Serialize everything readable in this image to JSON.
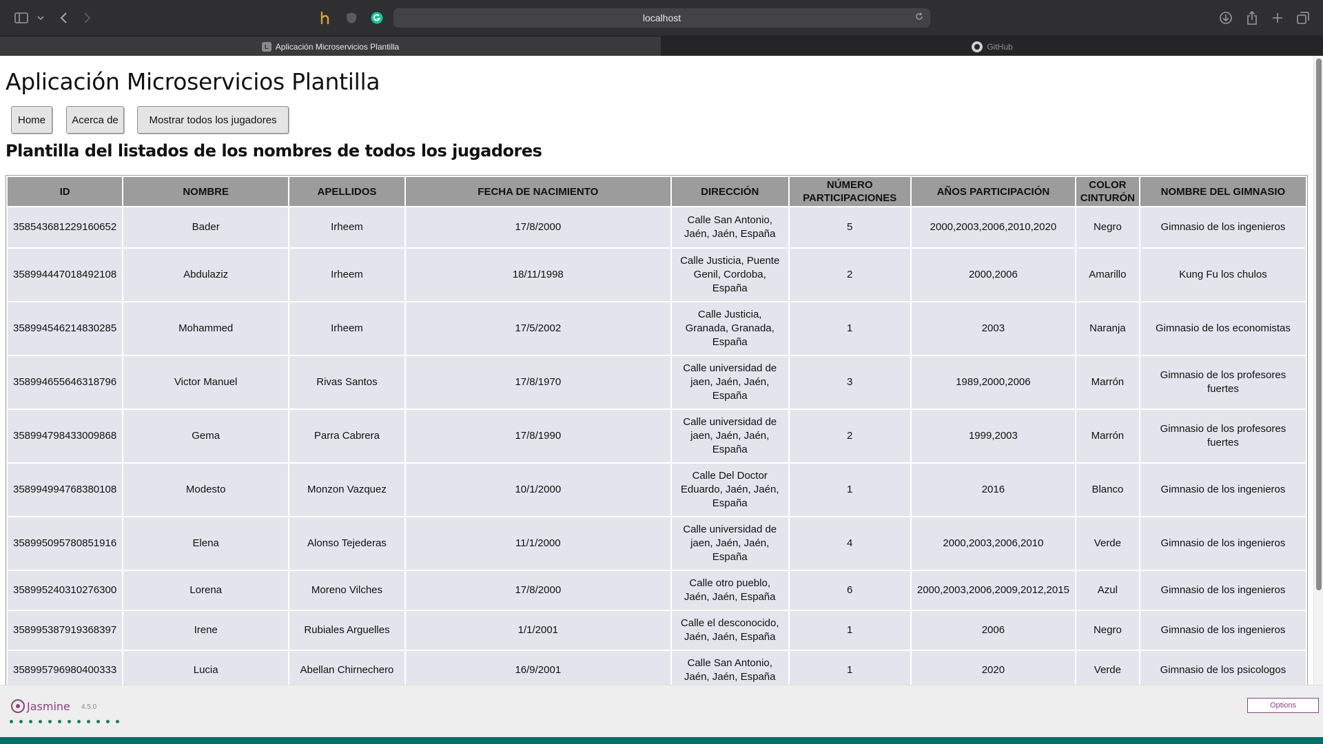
{
  "browser": {
    "url": "localhost",
    "tabs": [
      {
        "label": "Aplicación Microservicios Plantilla",
        "favicon": "L"
      },
      {
        "label": "GitHub"
      }
    ]
  },
  "page": {
    "title": "Aplicación Microservicios Plantilla",
    "nav": [
      "Home",
      "Acerca de",
      "Mostrar todos los jugadores"
    ],
    "subtitle": "Plantilla del listados de los nombres de todos los jugadores"
  },
  "table": {
    "headers": [
      "ID",
      "Nombre",
      "Apellidos",
      "Fecha de nacimiento",
      "Dirección",
      "Número participaciones",
      "Años participación",
      "Color cinturón",
      "Nombre del gimnasio"
    ],
    "rows": [
      [
        "358543681229160652",
        "Bader",
        "Irheem",
        "17/8/2000",
        "Calle San Antonio, Jaén, Jaén, España",
        "5",
        "2000,2003,2006,2010,2020",
        "Negro",
        "Gimnasio de los ingenieros"
      ],
      [
        "358994447018492108",
        "Abdulaziz",
        "Irheem",
        "18/11/1998",
        "Calle Justicia, Puente Genil, Cordoba, España",
        "2",
        "2000,2006",
        "Amarillo",
        "Kung Fu los chulos"
      ],
      [
        "358994546214830285",
        "Mohammed",
        "Irheem",
        "17/5/2002",
        "Calle Justicia, Granada, Granada, España",
        "1",
        "2003",
        "Naranja",
        "Gimnasio de los economistas"
      ],
      [
        "358994655646318796",
        "Victor Manuel",
        "Rivas Santos",
        "17/8/1970",
        "Calle universidad de jaen, Jaén, Jaén, España",
        "3",
        "1989,2000,2006",
        "Marrón",
        "Gimnasio de los profesores fuertes"
      ],
      [
        "358994798433009868",
        "Gema",
        "Parra Cabrera",
        "17/8/1990",
        "Calle universidad de jaen, Jaén, Jaén, España",
        "2",
        "1999,2003",
        "Marrón",
        "Gimnasio de los profesores fuertes"
      ],
      [
        "358994994768380108",
        "Modesto",
        "Monzon Vazquez",
        "10/1/2000",
        "Calle Del Doctor Eduardo, Jaén, Jaén, España",
        "1",
        "2016",
        "Blanco",
        "Gimnasio de los ingenieros"
      ],
      [
        "358995095780851916",
        "Elena",
        "Alonso Tejederas",
        "11/1/2000",
        "Calle universidad de jaen, Jaén, Jaén, España",
        "4",
        "2000,2003,2006,2010",
        "Verde",
        "Gimnasio de los ingenieros"
      ],
      [
        "358995240310276300",
        "Lorena",
        "Moreno Vilches",
        "17/8/2000",
        "Calle otro pueblo, Jaén, Jaén, España",
        "6",
        "2000,2003,2006,2009,2012,2015",
        "Azul",
        "Gimnasio de los ingenieros"
      ],
      [
        "358995387919368397",
        "Irene",
        "Rubiales Arguelles",
        "1/1/2001",
        "Calle el desconocido, Jaén, Jaén, España",
        "1",
        "2006",
        "Negro",
        "Gimnasio de los ingenieros"
      ],
      [
        "358995796980400333",
        "Lucia",
        "Abellan Chirnechero",
        "16/9/2001",
        "Calle San Antonio, Jaén, Jaén, España",
        "1",
        "2020",
        "Verde",
        "Gimnasio de los psicologos"
      ]
    ]
  },
  "jasmine": {
    "name": "Jasmine",
    "version": "4.5.0",
    "options_label": "Options",
    "brand_color": "#8a4182",
    "bar_color": "#007069"
  },
  "icons": [
    "sidebar-icon",
    "chevron-down-icon",
    "back-icon",
    "forward-icon",
    "extension-icon",
    "shield-icon",
    "grammarly-icon",
    "reload-icon",
    "download-icon",
    "share-icon",
    "new-tab-icon",
    "tab-overview-icon"
  ]
}
